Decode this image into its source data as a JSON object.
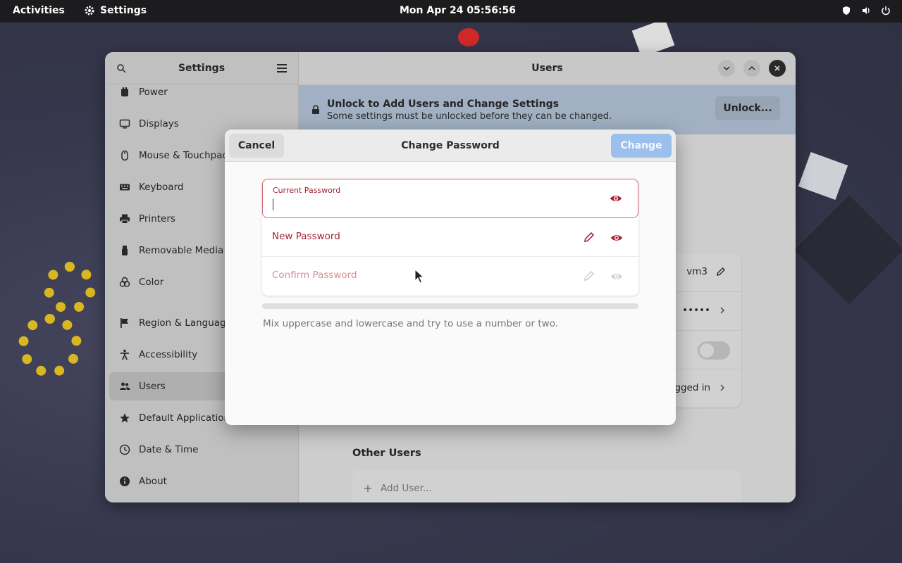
{
  "topbar": {
    "activities": "Activities",
    "app_name": "Settings",
    "clock": "Mon Apr 24  05:56:56"
  },
  "sidebar": {
    "title": "Settings",
    "items": [
      {
        "label": "Power",
        "icon": "power-icon"
      },
      {
        "label": "Displays",
        "icon": "display-icon"
      },
      {
        "label": "Mouse & Touchpad",
        "icon": "mouse-icon"
      },
      {
        "label": "Keyboard",
        "icon": "keyboard-icon"
      },
      {
        "label": "Printers",
        "icon": "printer-icon"
      },
      {
        "label": "Removable Media",
        "icon": "usb-icon"
      },
      {
        "label": "Color",
        "icon": "color-icon"
      },
      {
        "label": "Region & Language",
        "icon": "flag-icon"
      },
      {
        "label": "Accessibility",
        "icon": "accessibility-icon"
      },
      {
        "label": "Users",
        "icon": "users-icon",
        "active": true
      },
      {
        "label": "Default Applications",
        "icon": "star-icon"
      },
      {
        "label": "Date & Time",
        "icon": "clock-icon"
      },
      {
        "label": "About",
        "icon": "info-icon"
      }
    ]
  },
  "main": {
    "title": "Users",
    "unlock": {
      "title": "Unlock to Add Users and Change Settings",
      "subtitle": "Some settings must be unlocked before they can be changed.",
      "button": "Unlock..."
    },
    "user_card": {
      "name_value": "vm3",
      "password_value": "•••••",
      "login_value": "ogged in"
    },
    "other_users_title": "Other Users",
    "add_user": "Add User..."
  },
  "dialog": {
    "title": "Change Password",
    "cancel": "Cancel",
    "change": "Change",
    "current_password_label": "Current Password",
    "current_password_value": "",
    "new_password_label": "New Password",
    "confirm_password_label": "Confirm Password",
    "hint": "Mix uppercase and lowercase and try to use a number or two.",
    "strength": 0
  },
  "colors": {
    "accent": "#9cc0ec",
    "error": "#a52232",
    "banner": "#c5d8ee"
  }
}
